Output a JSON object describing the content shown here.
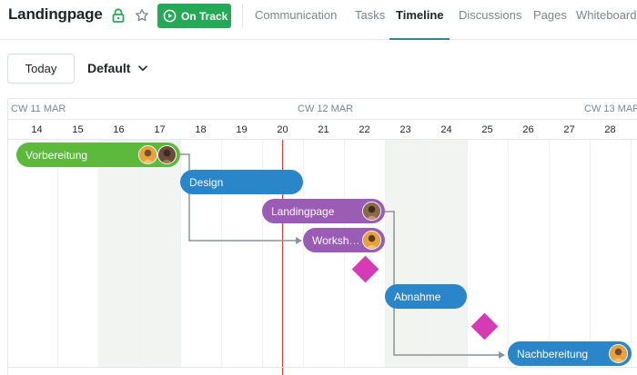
{
  "header": {
    "project_title": "Landingpage",
    "status": "On Track",
    "tabs": [
      {
        "label": "Communication",
        "active": false
      },
      {
        "label": "Tasks",
        "active": false
      },
      {
        "label": "Timeline",
        "active": true
      },
      {
        "label": "Discussions",
        "active": false
      },
      {
        "label": "Pages",
        "active": false
      },
      {
        "label": "Whiteboard",
        "active": false
      }
    ]
  },
  "toolbar": {
    "today_label": "Today",
    "view_label": "Default"
  },
  "timeline": {
    "weeks": [
      {
        "label": "CW 11 MAR"
      },
      {
        "label": "CW 12 MAR"
      },
      {
        "label": "CW 13 MAR"
      }
    ],
    "days": [
      "14",
      "15",
      "16",
      "17",
      "18",
      "19",
      "20",
      "21",
      "22",
      "23",
      "24",
      "25",
      "26",
      "27",
      "28"
    ],
    "tasks": [
      {
        "label": "Vorbereitung",
        "color": "#5cb93c"
      },
      {
        "label": "Design",
        "color": "#2b86c9"
      },
      {
        "label": "Landingpage",
        "color": "#9a5cb4"
      },
      {
        "label": "Worksh…",
        "color": "#9a5cb4"
      },
      {
        "label": "Abnahme",
        "color": "#2b86c9"
      },
      {
        "label": "Nachbereitung",
        "color": "#2b86c9"
      }
    ]
  },
  "colors": {
    "accent": "#2a8a8e",
    "status_green": "#24a957",
    "today_marker": "#e0343a",
    "milestone": "#d43bb5"
  },
  "icons": {
    "lock": "lock-icon",
    "star": "star-icon",
    "status": "play-circle-icon",
    "chevron": "chevron-down-icon"
  }
}
